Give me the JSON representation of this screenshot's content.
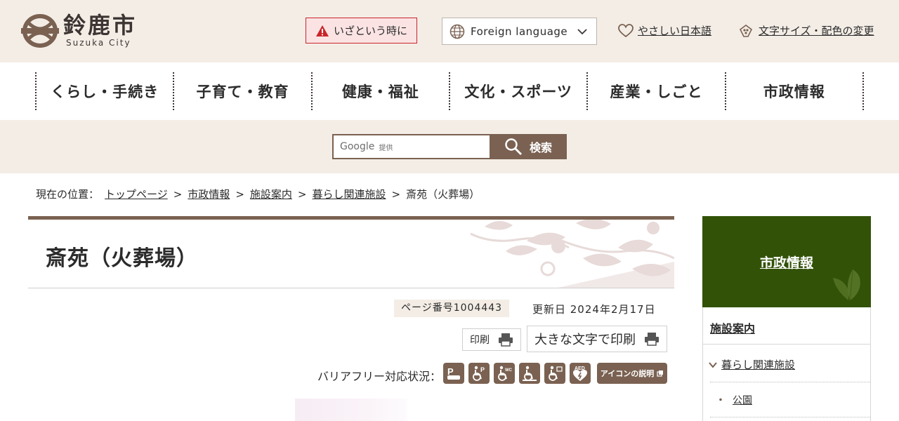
{
  "header": {
    "logo": {
      "name": "鈴鹿市",
      "sub": "Suzuka City"
    },
    "emergency_label": "いざという時に",
    "language_label": "Foreign language",
    "easy_japanese_label": "やさしい日本語",
    "text_size_label": "文字サイズ・配色の変更"
  },
  "nav": {
    "items": [
      "くらし・手続き",
      "子育て・教育",
      "健康・福祉",
      "文化・スポーツ",
      "産業・しごと",
      "市政情報"
    ]
  },
  "search": {
    "provider": "Google",
    "provider_note": "提供",
    "button_label": "検索"
  },
  "breadcrumb": {
    "prefix": "現在の位置：",
    "items": [
      "トップページ",
      "市政情報",
      "施設案内",
      "暮らし関連施設"
    ],
    "current": "斎苑（火葬場）",
    "separator": ">"
  },
  "page": {
    "title": "斎苑（火葬場）",
    "page_number": "ページ番号1004443",
    "updated": "更新日 2024年2月17日",
    "print_label": "印刷",
    "print_large_label": "大きな文字で印刷",
    "barrier_free_label": "バリアフリー対応状況：",
    "barrier_free_icons": [
      "parking-icon",
      "accessible-parking-icon",
      "accessible-toilet-icon",
      "accessible-entrance-icon",
      "wheelchair-rental-icon",
      "aed-icon"
    ],
    "icon_explain_label": "アイコンの説明"
  },
  "sidebar": {
    "heading": "市政情報",
    "level1": "施設案内",
    "level2": "暮らし関連施設",
    "level3": "公園"
  },
  "colors": {
    "brand_brown": "#7a6151",
    "header_bg": "#f3ede6",
    "sidebar_green": "#325208",
    "emergency_red": "#c9252a"
  }
}
